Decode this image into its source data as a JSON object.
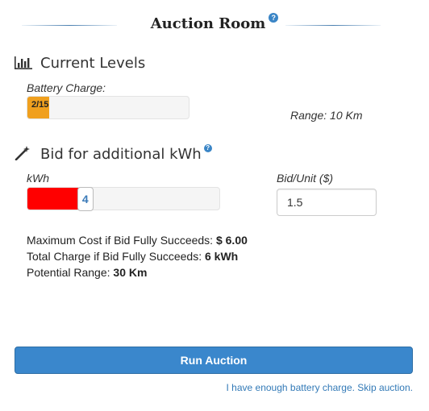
{
  "header": {
    "title": "Auction Room",
    "help_icon": "question-circle-icon"
  },
  "current_levels": {
    "title": "Current Levels",
    "icon": "bar-chart-icon",
    "battery_label": "Battery Charge:",
    "battery_text": "2/15",
    "battery_fraction": 0.133,
    "battery_color": "#f0a01e",
    "range_text": "Range: 10 Km"
  },
  "bid": {
    "title": "Bid for additional kWh",
    "icon": "magic-wand-icon",
    "help_icon": "question-circle-icon",
    "kwh_label": "kWh",
    "kwh_value": "4",
    "kwh_fraction": 0.27,
    "slider_color": "#ff0000",
    "bid_unit_label": "Bid/Unit ($)",
    "bid_unit_value": "1.5"
  },
  "summary": {
    "max_cost_label": "Maximum Cost if Bid Fully Succeeds: ",
    "max_cost_value": "$ 6.00",
    "total_charge_label": "Total Charge if Bid Fully Succeeds: ",
    "total_charge_value": "6 kWh",
    "potential_range_label": "Potential Range: ",
    "potential_range_value": "30 Km"
  },
  "actions": {
    "run_label": "Run Auction",
    "skip_label": "I have enough battery charge. Skip auction.",
    "accent_color": "#3a87cc"
  }
}
